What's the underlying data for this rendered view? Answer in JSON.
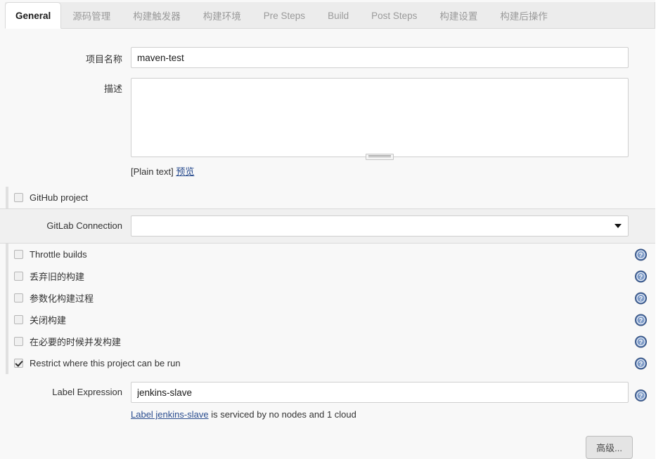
{
  "tabs": [
    {
      "label": "General",
      "active": true
    },
    {
      "label": "源码管理",
      "active": false
    },
    {
      "label": "构建触发器",
      "active": false
    },
    {
      "label": "构建环境",
      "active": false
    },
    {
      "label": "Pre Steps",
      "active": false
    },
    {
      "label": "Build",
      "active": false
    },
    {
      "label": "Post Steps",
      "active": false
    },
    {
      "label": "构建设置",
      "active": false
    },
    {
      "label": "构建后操作",
      "active": false
    }
  ],
  "form": {
    "project_name": {
      "label": "项目名称",
      "value": "maven-test",
      "placeholder": ""
    },
    "description": {
      "label": "描述",
      "value": "",
      "placeholder": "",
      "plain_text_label": "[Plain text]",
      "preview_link": "预览"
    },
    "github_project": {
      "label": "GitHub project",
      "checked": false
    },
    "gitlab_connection": {
      "label": "GitLab Connection",
      "value": "",
      "arrow_icon": "chevron-down-icon"
    },
    "checkboxes": [
      {
        "label": "Throttle builds",
        "checked": false,
        "help": "help-icon"
      },
      {
        "label": "丢弃旧的构建",
        "checked": false,
        "help": "help-icon"
      },
      {
        "label": "参数化构建过程",
        "checked": false,
        "help": "help-icon"
      },
      {
        "label": "关闭构建",
        "checked": false,
        "help": "help-icon"
      },
      {
        "label": "在必要的时候并发构建",
        "checked": false,
        "help": "help-icon"
      },
      {
        "label": "Restrict where this project can be run",
        "checked": true,
        "help": "help-icon"
      }
    ],
    "label_expression": {
      "label": "Label Expression",
      "value": "jenkins-slave",
      "note_link": "Label jenkins-slave",
      "note_rest": " is serviced by no nodes and 1 cloud"
    },
    "advanced_button": "高级..."
  },
  "colors": {
    "page_bg": "#f8f8f8",
    "input_border": "#cfcfcf",
    "link": "#2a4d8f",
    "help_blue": "#4b6ea9",
    "tab_inactive_text": "#9a9a9a",
    "optional_bar": "#e0e0e0"
  }
}
